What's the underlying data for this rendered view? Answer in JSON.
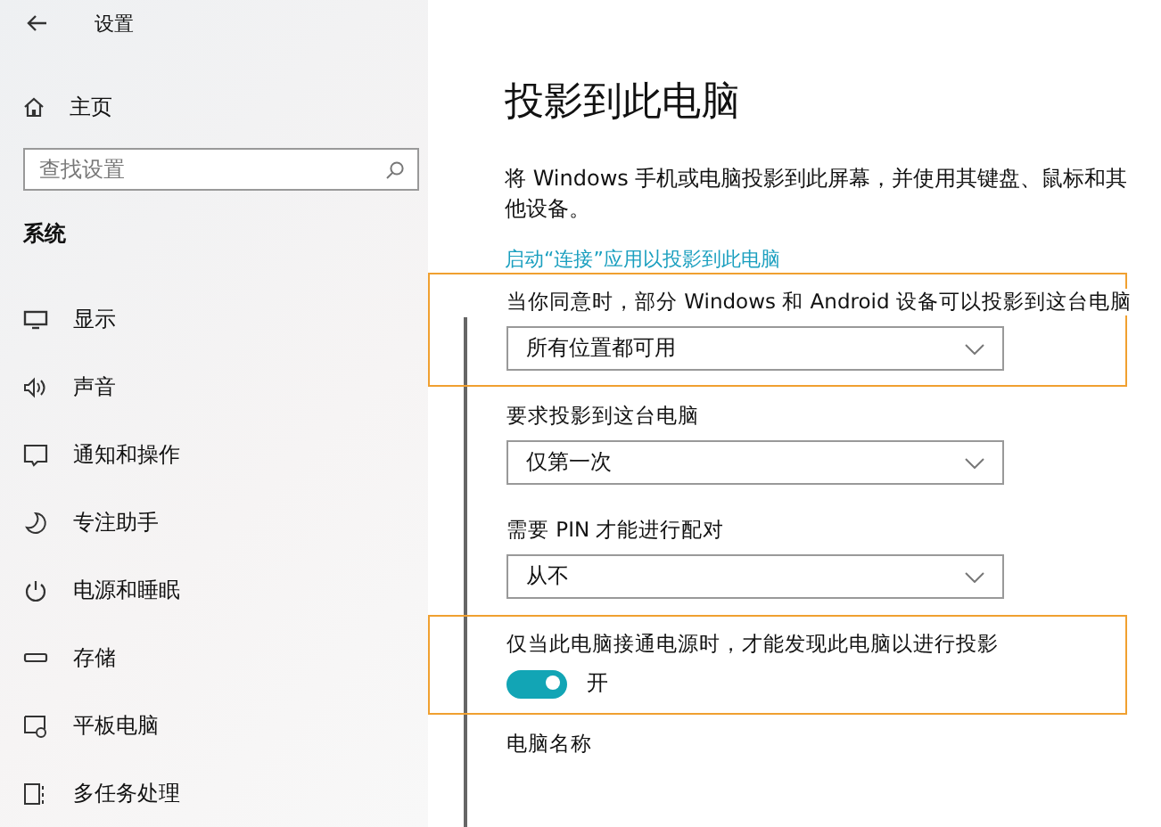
{
  "window": {
    "title": "设置"
  },
  "sidebar": {
    "home": "主页",
    "search": {
      "placeholder": "查找设置"
    },
    "section": "系统",
    "items": [
      {
        "label": "显示"
      },
      {
        "label": "声音"
      },
      {
        "label": "通知和操作"
      },
      {
        "label": "专注助手"
      },
      {
        "label": "电源和睡眠"
      },
      {
        "label": "存储"
      },
      {
        "label": "平板电脑"
      },
      {
        "label": "多任务处理"
      }
    ]
  },
  "main": {
    "title": "投影到此电脑",
    "description": "将 Windows 手机或电脑投影到此屏幕，并使用其键盘、鼠标和其他设备。",
    "link": "启动“连接”应用以投影到此电脑",
    "settings": [
      {
        "kind": "dropdown",
        "label": "当你同意时，部分 Windows 和 Android 设备可以投影到这台电脑",
        "value": "所有位置都可用",
        "highlighted": true
      },
      {
        "kind": "dropdown",
        "label": "要求投影到这台电脑",
        "value": "仅第一次",
        "highlighted": false
      },
      {
        "kind": "dropdown",
        "label": "需要 PIN 才能进行配对",
        "value": "从不",
        "highlighted": false
      },
      {
        "kind": "toggle",
        "label": "仅当此电脑接通电源时，才能发现此电脑以进行投影",
        "on": true,
        "state_label": "开",
        "highlighted": true
      },
      {
        "kind": "label",
        "label": "电脑名称",
        "highlighted": false
      }
    ]
  }
}
